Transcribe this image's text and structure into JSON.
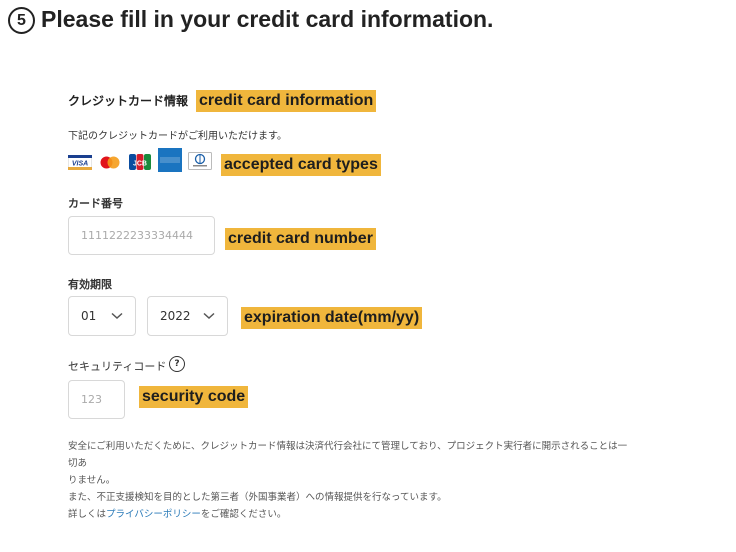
{
  "step": {
    "number": "5",
    "title": "Please fill in your credit card information."
  },
  "section": {
    "heading": "クレジットカード情報",
    "note": "下記のクレジットカードがご利用いただけます。"
  },
  "card_brands": [
    "VISA",
    "Mastercard",
    "JCB",
    "AMERICAN EXPRESS",
    "Diners Club"
  ],
  "card_number": {
    "label": "カード番号",
    "placeholder": "1111222233334444"
  },
  "expiration": {
    "label": "有効期限",
    "month": "01",
    "year": "2022"
  },
  "security_code": {
    "label": "セキュリティコード",
    "placeholder": "123"
  },
  "annotations": {
    "credit_card_information": "credit card information",
    "accepted_card_types": "accepted card types",
    "credit_card_number": "credit card number",
    "expiration_date": "expiration date(mm/yy)",
    "security_code": "security code"
  },
  "disclaimer": {
    "line1": "安全にご利用いただくために、クレジットカード情報は決済代行会社にて管理しており、プロジェクト実行者に開示されることは一切あ",
    "line2": "りません。",
    "line3": "また、不正支援検知を目的とした第三者（外国事業者）への情報提供を行なっています。",
    "line4_prefix": "詳しくは",
    "line4_link": "プライバシーポリシー",
    "line4_suffix": "をご確認ください。"
  },
  "colors": {
    "annotation_highlight": "#f0b63c",
    "link": "#2a7ab8"
  }
}
